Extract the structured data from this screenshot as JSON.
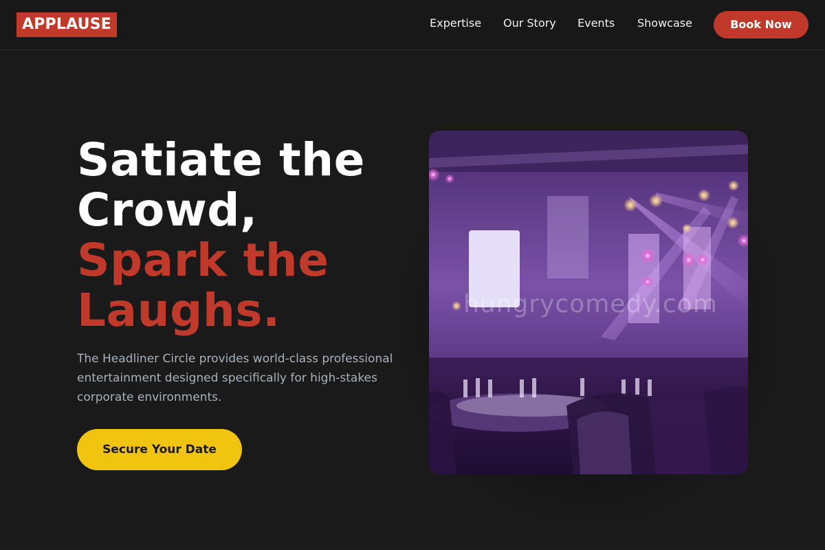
{
  "brand": {
    "logo_text": "APPLAUSE",
    "accent": "#c0392b"
  },
  "nav": {
    "items": [
      "Expertise",
      "Our Story",
      "Events",
      "Showcase"
    ],
    "cta_label": "Book Now"
  },
  "hero": {
    "headline_line1": "Satiate the",
    "headline_line2": "Crowd,",
    "headline_line3": "Spark the",
    "headline_line4": "Laughs.",
    "description": "The Headliner Circle provides world-class professional entertainment designed specifically for high-stakes corporate environments.",
    "cta_label": "Secure Your Date",
    "cta_color": "#f1c40f"
  },
  "image": {
    "subject": "concert-venue-photo",
    "watermark": "hungrycomedy.com"
  }
}
